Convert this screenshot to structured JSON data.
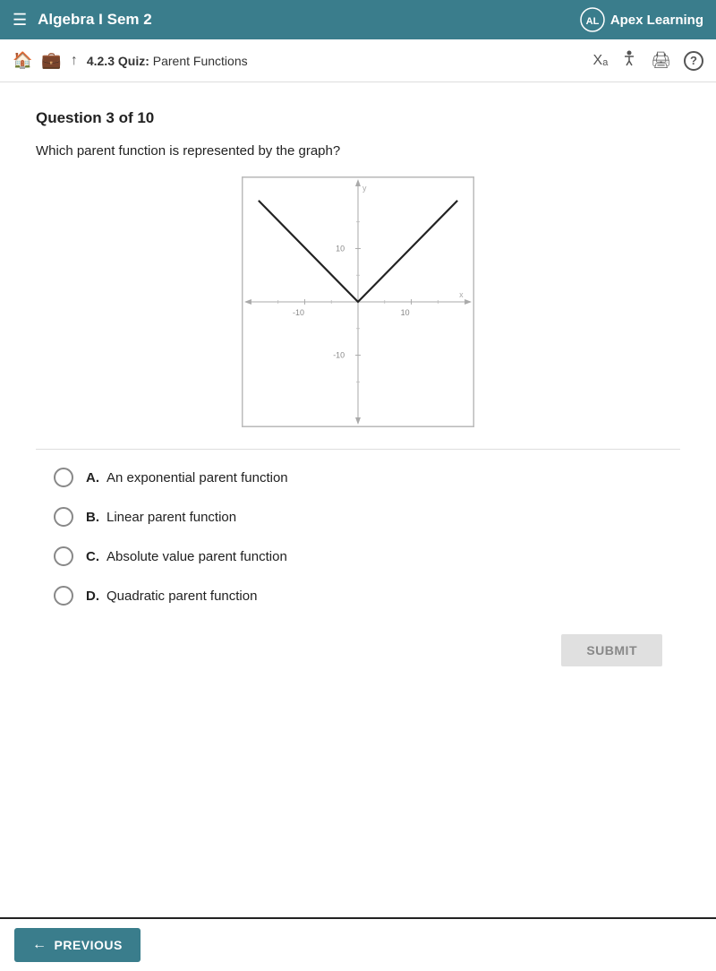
{
  "topbar": {
    "menu_icon": "☰",
    "title": "Algebra I Sem 2",
    "apex_logo_text": "Apex Learning"
  },
  "secondbar": {
    "home_icon": "⌂",
    "briefcase_icon": "💼",
    "up_icon": "↑",
    "breadcrumb_prefix": "4.2.3  Quiz:",
    "breadcrumb_quiz": "Parent Functions",
    "translate_icon": "Xₐ",
    "person_icon": "👤",
    "print_icon": "🖨",
    "help_icon": "?"
  },
  "question": {
    "number_label": "Question 3 of 10",
    "text": "Which parent function is represented by the graph?"
  },
  "options": [
    {
      "letter": "A.",
      "text": "An exponential parent function"
    },
    {
      "letter": "B.",
      "text": "Linear parent function"
    },
    {
      "letter": "C.",
      "text": "Absolute value parent function"
    },
    {
      "letter": "D.",
      "text": "Quadratic parent function"
    }
  ],
  "buttons": {
    "submit_label": "SUBMIT",
    "previous_label": "PREVIOUS"
  },
  "graph": {
    "x_label": "x",
    "y_label": "y",
    "tick_positive_x": "10",
    "tick_negative_x": "-10",
    "tick_positive_y": "10",
    "tick_negative_y": "-10"
  }
}
